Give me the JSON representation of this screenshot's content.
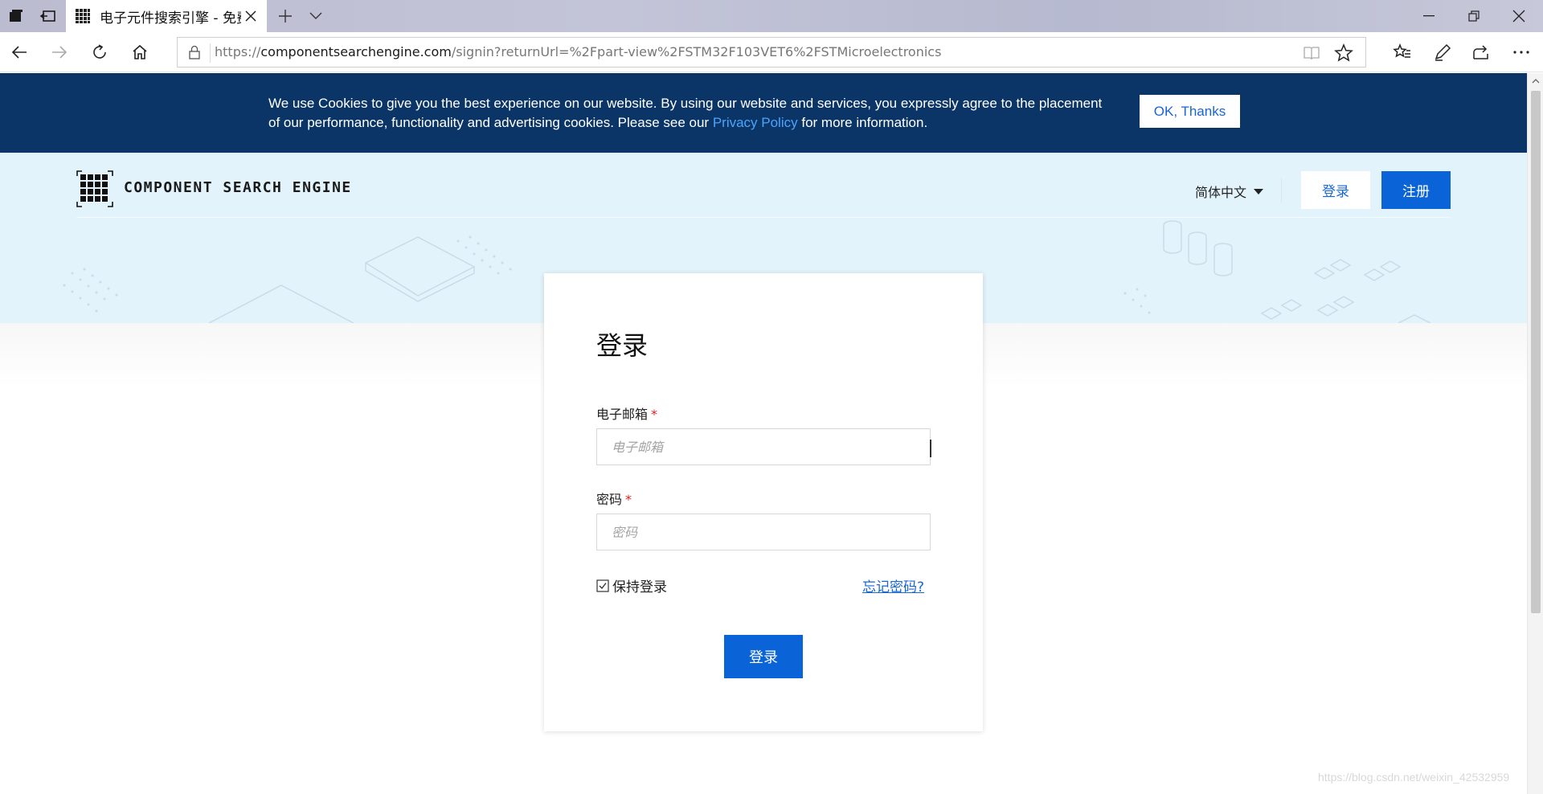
{
  "browser": {
    "tab_title": "电子元件搜索引擎 - 免费",
    "url_prefix": "https://",
    "url_host": "componentsearchengine.com",
    "url_path": "/signin?returnUrl=%2Fpart-view%2FSTM32F103VET6%2FSTMicroelectronics"
  },
  "cookie_banner": {
    "text_before": "We use Cookies to give you the best experience on our website. By using our website and services, you expressly agree to the placement of our performance, functionality and advertising cookies. Please see our ",
    "link_text": "Privacy Policy",
    "text_after": " for more information.",
    "button_label": "OK, Thanks"
  },
  "header": {
    "brand": "COMPONENT SEARCH ENGINE",
    "language": "简体中文",
    "login_label": "登录",
    "register_label": "注册"
  },
  "login_card": {
    "title": "登录",
    "email_label": "电子邮箱",
    "email_placeholder": "电子邮箱",
    "email_value": "",
    "password_label": "密码",
    "password_placeholder": "密码",
    "password_value": "",
    "required_mark": "*",
    "remember_label": "保持登录",
    "remember_checked": true,
    "forgot_label": "忘记密码?",
    "submit_label": "登录"
  },
  "watermark": "https://blog.csdn.net/weixin_42532959",
  "colors": {
    "cookie_bg": "#0b3566",
    "hero_bg": "#e3f3fb",
    "primary": "#0b63d8",
    "link": "#1865d6",
    "required": "#e02020"
  }
}
